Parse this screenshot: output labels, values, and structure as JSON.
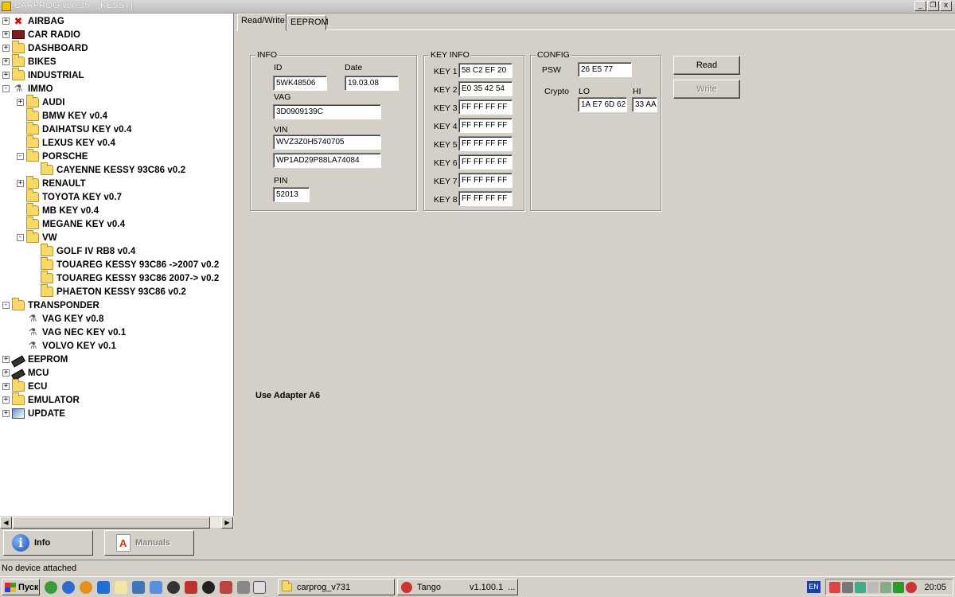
{
  "window": {
    "title": "CARPROG  v08.35 - [KESSY]",
    "controls": [
      "_",
      " ",
      "x"
    ]
  },
  "tree": [
    {
      "label": "AIRBAG",
      "icon": "airbag-icon",
      "expander": "+"
    },
    {
      "label": "CAR RADIO",
      "icon": "car-radio-icon",
      "expander": "+"
    },
    {
      "label": "DASHBOARD",
      "icon": "folder-icon",
      "expander": "+"
    },
    {
      "label": "BIKES",
      "icon": "folder-icon",
      "expander": "+"
    },
    {
      "label": "INDUSTRIAL",
      "icon": "folder-icon",
      "expander": "+"
    },
    {
      "label": "IMMO",
      "icon": "key-icon",
      "expander": "-"
    },
    {
      "label": "AUDI",
      "icon": "folder-icon",
      "expander": "+"
    },
    {
      "label": "BMW KEY v0.4",
      "icon": "folder-icon",
      "expander": ""
    },
    {
      "label": "DAIHATSU KEY v0.4",
      "icon": "folder-icon",
      "expander": ""
    },
    {
      "label": "LEXUS KEY v0.4",
      "icon": "folder-icon",
      "expander": ""
    },
    {
      "label": "PORSCHE",
      "icon": "folder-icon",
      "expander": "-"
    },
    {
      "label": "CAYENNE KESSY 93C86 v0.2",
      "icon": "folder-icon",
      "expander": ""
    },
    {
      "label": "RENAULT",
      "icon": "folder-icon",
      "expander": "+"
    },
    {
      "label": "TOYOTA KEY v0.7",
      "icon": "folder-icon",
      "expander": ""
    },
    {
      "label": "MB KEY v0.4",
      "icon": "folder-icon",
      "expander": ""
    },
    {
      "label": "MEGANE KEY v0.4",
      "icon": "folder-icon",
      "expander": ""
    },
    {
      "label": "VW",
      "icon": "folder-icon",
      "expander": "-"
    },
    {
      "label": "GOLF IV RB8 v0.4",
      "icon": "folder-icon",
      "expander": ""
    },
    {
      "label": "TOUAREG KESSY 93C86 ->2007 v0.2",
      "icon": "folder-icon",
      "expander": ""
    },
    {
      "label": "TOUAREG KESSY 93C86 2007-> v0.2",
      "icon": "folder-icon",
      "expander": ""
    },
    {
      "label": "PHAETON KESSY 93C86 v0.2",
      "icon": "folder-icon",
      "expander": ""
    },
    {
      "label": "TRANSPONDER",
      "icon": "folder-icon",
      "expander": "-"
    },
    {
      "label": "VAG KEY v0.8",
      "icon": "key-icon",
      "expander": ""
    },
    {
      "label": "VAG NEC KEY v0.1",
      "icon": "key-icon",
      "expander": ""
    },
    {
      "label": "VOLVO KEY v0.1",
      "icon": "key-icon",
      "expander": ""
    },
    {
      "label": "EEPROM",
      "icon": "chip-icon",
      "expander": "+"
    },
    {
      "label": "MCU",
      "icon": "chip-icon",
      "expander": "+"
    },
    {
      "label": "ECU",
      "icon": "folder-icon",
      "expander": "+"
    },
    {
      "label": "EMULATOR",
      "icon": "folder-icon",
      "expander": "+"
    },
    {
      "label": "UPDATE",
      "icon": "update-icon",
      "expander": "+"
    }
  ],
  "left_buttons": {
    "info": "Info",
    "manuals": "Manuals"
  },
  "tabs": [
    "Read/Write",
    "EEPROM"
  ],
  "info_group": {
    "title": "INFO",
    "id_label": "ID",
    "id_value": "5WK48506",
    "date_label": "Date",
    "date_value": "19.03.08",
    "vag_label": "VAG",
    "vag_value": "3D0909139C",
    "vin_label": "VIN",
    "vin_value1": "WVZ3Z0H5740705",
    "vin_value2": "WP1AD29P88LA74084",
    "pin_label": "PIN",
    "pin_value": "52013"
  },
  "key_info": {
    "title": "KEY INFO",
    "keys": [
      {
        "label": "KEY 1",
        "value": "58 C2 EF 20"
      },
      {
        "label": "KEY 2",
        "value": "E0 35 42 54"
      },
      {
        "label": "KEY 3",
        "value": "FF FF FF FF"
      },
      {
        "label": "KEY 4",
        "value": "FF FF FF FF"
      },
      {
        "label": "KEY 5",
        "value": "FF FF FF FF"
      },
      {
        "label": "KEY 6",
        "value": "FF FF FF FF"
      },
      {
        "label": "KEY 7",
        "value": "FF FF FF FF"
      },
      {
        "label": "KEY 8",
        "value": "FF FF FF FF"
      }
    ]
  },
  "config": {
    "title": "CONFIG",
    "psw_label": "PSW",
    "psw_value": "26 E5 77",
    "crypto_label": "Crypto",
    "lo_label": "LO",
    "lo_value": "1A E7 6D 62",
    "hi_label": "HI",
    "hi_value": "33 AA"
  },
  "actions": {
    "read": "Read",
    "write": "Write"
  },
  "adapter_note": "Use Adapter A6",
  "status": "No device attached",
  "taskbar": {
    "start": "Пуск",
    "items": [
      "carprog_v731",
      "Tango",
      "v1.100.1",
      "..."
    ],
    "lang": "EN",
    "clock": "20:05"
  }
}
